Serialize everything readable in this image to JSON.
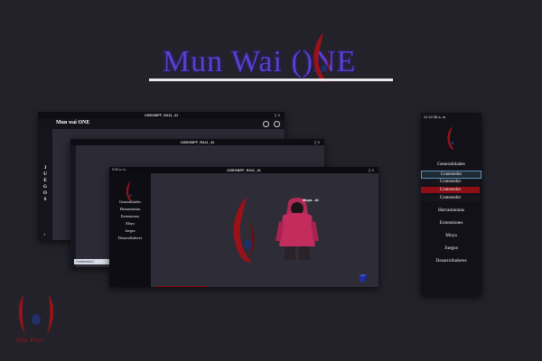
{
  "hero": {
    "logo_text": "Mun Wai ()NE"
  },
  "window1": {
    "title": "OSEGBFF_R411_41",
    "title_controls": "▯ X",
    "app_title": "Mun wai ONE",
    "vertical_label": "JUEGOS",
    "side_number": "1"
  },
  "window2": {
    "title": "OSEGBFF_R411_41",
    "title_controls": "▯ X",
    "content_label": "Contenedor1"
  },
  "window3": {
    "title": "OSEGBFF_R411_41",
    "title_controls": "▯ X",
    "time": "9:06 a. m.",
    "menu": [
      "Generalidades",
      "Herramientas",
      "Extensiones",
      "Moya",
      "Juegos",
      "Desarrolladores"
    ],
    "caption": "Moya - AI"
  },
  "right_panel": {
    "time": "11:12:35 a. m.",
    "items_top": [
      "Generalidades"
    ],
    "subitems": [
      "Contenedor",
      "Contenedor",
      "Contenedor",
      "Contenedor"
    ],
    "items_bottom": [
      "Herramientas",
      "Extensiones",
      "Moya",
      "Juegos",
      "Desarrolladores"
    ]
  },
  "bottom_logo": {
    "text": "Oda Pent"
  },
  "colors": {
    "background": "#23222b",
    "accent_red": "#8d0f15",
    "accent_purple": "#5a3fd0",
    "accent_blue": "#5f8fb5"
  }
}
